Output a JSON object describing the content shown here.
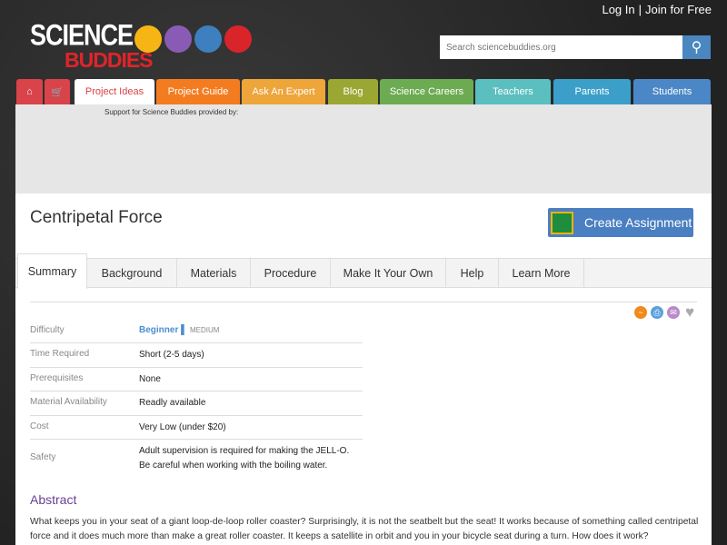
{
  "header": {
    "login": "Log In",
    "separator": "|",
    "join": "Join for Free",
    "logo_line1": "SCIENCE",
    "logo_line2": "BUDDIES",
    "search_placeholder": "Search sciencebuddies.org"
  },
  "nav": [
    {
      "label": "Project Ideas",
      "color": "#ffffff"
    },
    {
      "label": "Project Guide",
      "color": "#f47c20"
    },
    {
      "label": "Ask An Expert",
      "color": "#eea53a"
    },
    {
      "label": "Blog",
      "color": "#9aa833"
    },
    {
      "label": "Science Careers",
      "color": "#6cab52"
    },
    {
      "label": "Teachers",
      "color": "#5bbfc0"
    },
    {
      "label": "Parents",
      "color": "#3b9fc9"
    },
    {
      "label": "Students",
      "color": "#4b87c6"
    }
  ],
  "ad": {
    "support_text": "Support for Science Buddies provided by:"
  },
  "page": {
    "title": "Centripetal Force",
    "create_assignment": "Create Assignment"
  },
  "tabs": [
    "Summary",
    "Background",
    "Materials",
    "Procedure",
    "Make It Your Own",
    "Help",
    "Learn More"
  ],
  "summary": [
    {
      "label": "Difficulty",
      "value": "Beginner",
      "extra": "MEDIUM"
    },
    {
      "label": "Time Required",
      "value": "Short (2-5 days)"
    },
    {
      "label": "Prerequisites",
      "value": "None"
    },
    {
      "label": "Material Availability",
      "value": "Readly available"
    },
    {
      "label": "Cost",
      "value": "Very Low (under $20)"
    },
    {
      "label": "Safety",
      "value": "Adult supervision is required for making the JELL-O. Be careful when working with the boiling water."
    }
  ],
  "abstract": {
    "heading": "Abstract",
    "text": "What keeps you in your seat of a giant loop-de-loop roller coaster? Surprisingly, it is not the seatbelt but the seat! It works because of something called centripetal force and it does much more than make a great roller coaster. It keeps a satellite in orbit and you in your bicycle seat during a turn. How does it work?"
  }
}
